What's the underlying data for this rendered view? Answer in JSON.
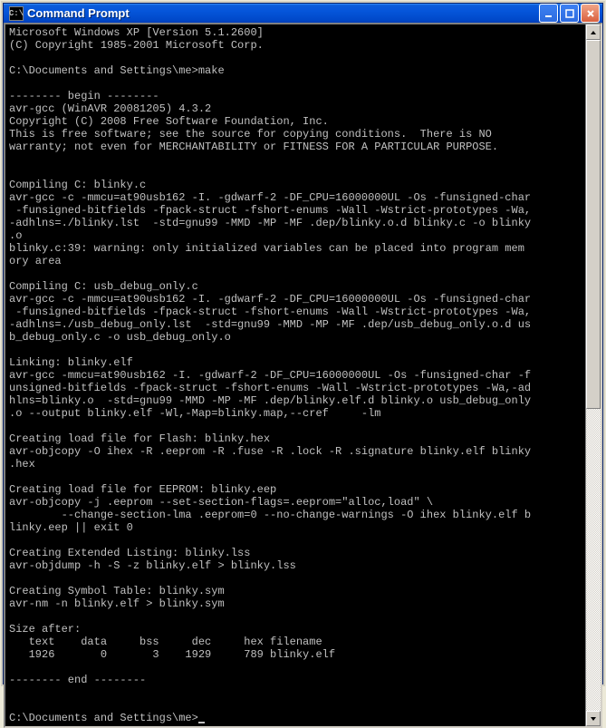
{
  "window": {
    "icon_text": "C:\\",
    "title": "Command Prompt",
    "buttons": {
      "min": "_",
      "max": "□",
      "close": "×"
    }
  },
  "terminal": {
    "lines": [
      "Microsoft Windows XP [Version 5.1.2600]",
      "(C) Copyright 1985-2001 Microsoft Corp.",
      "",
      "C:\\Documents and Settings\\me>make",
      "",
      "-------- begin --------",
      "avr-gcc (WinAVR 20081205) 4.3.2",
      "Copyright (C) 2008 Free Software Foundation, Inc.",
      "This is free software; see the source for copying conditions.  There is NO",
      "warranty; not even for MERCHANTABILITY or FITNESS FOR A PARTICULAR PURPOSE.",
      "",
      "",
      "Compiling C: blinky.c",
      "avr-gcc -c -mmcu=at90usb162 -I. -gdwarf-2 -DF_CPU=16000000UL -Os -funsigned-char",
      " -funsigned-bitfields -fpack-struct -fshort-enums -Wall -Wstrict-prototypes -Wa,",
      "-adhlns=./blinky.lst  -std=gnu99 -MMD -MP -MF .dep/blinky.o.d blinky.c -o blinky",
      ".o",
      "blinky.c:39: warning: only initialized variables can be placed into program mem",
      "ory area",
      "",
      "Compiling C: usb_debug_only.c",
      "avr-gcc -c -mmcu=at90usb162 -I. -gdwarf-2 -DF_CPU=16000000UL -Os -funsigned-char",
      " -funsigned-bitfields -fpack-struct -fshort-enums -Wall -Wstrict-prototypes -Wa,",
      "-adhlns=./usb_debug_only.lst  -std=gnu99 -MMD -MP -MF .dep/usb_debug_only.o.d us",
      "b_debug_only.c -o usb_debug_only.o",
      "",
      "Linking: blinky.elf",
      "avr-gcc -mmcu=at90usb162 -I. -gdwarf-2 -DF_CPU=16000000UL -Os -funsigned-char -f",
      "unsigned-bitfields -fpack-struct -fshort-enums -Wall -Wstrict-prototypes -Wa,-ad",
      "hlns=blinky.o  -std=gnu99 -MMD -MP -MF .dep/blinky.elf.d blinky.o usb_debug_only",
      ".o --output blinky.elf -Wl,-Map=blinky.map,--cref     -lm",
      "",
      "Creating load file for Flash: blinky.hex",
      "avr-objcopy -O ihex -R .eeprom -R .fuse -R .lock -R .signature blinky.elf blinky",
      ".hex",
      "",
      "Creating load file for EEPROM: blinky.eep",
      "avr-objcopy -j .eeprom --set-section-flags=.eeprom=\"alloc,load\" \\",
      "        --change-section-lma .eeprom=0 --no-change-warnings -O ihex blinky.elf b",
      "linky.eep || exit 0",
      "",
      "Creating Extended Listing: blinky.lss",
      "avr-objdump -h -S -z blinky.elf > blinky.lss",
      "",
      "Creating Symbol Table: blinky.sym",
      "avr-nm -n blinky.elf > blinky.sym",
      "",
      "Size after:",
      "   text    data     bss     dec     hex filename",
      "   1926       0       3    1929     789 blinky.elf",
      "",
      "-------- end --------",
      "",
      "",
      "C:\\Documents and Settings\\me>"
    ],
    "prompt_cursor": true
  }
}
